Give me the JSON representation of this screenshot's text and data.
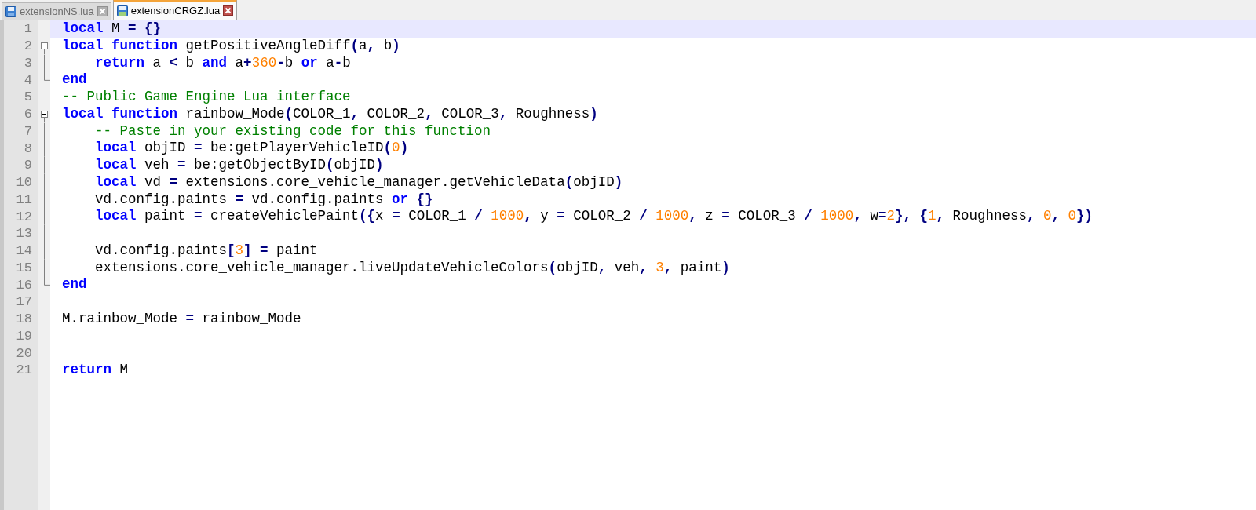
{
  "tabs": [
    {
      "label": "extensionNS.lua",
      "selected": false
    },
    {
      "label": "extensionCRGZ.lua",
      "selected": true
    }
  ],
  "editor": {
    "lines": [
      {
        "number": "1",
        "current": true,
        "kind": "plain",
        "tokens": [
          {
            "kind": "keyword",
            "text": "local"
          },
          {
            "kind": "text",
            "text": " M "
          },
          {
            "kind": "operator",
            "text": "= {}"
          }
        ]
      },
      {
        "number": "2",
        "current": false,
        "kind": "fold_start",
        "tokens": [
          {
            "kind": "keyword",
            "text": "local function"
          },
          {
            "kind": "text",
            "text": " getPositiveAngleDiff"
          },
          {
            "kind": "operator",
            "text": "("
          },
          {
            "kind": "text",
            "text": "a"
          },
          {
            "kind": "operator",
            "text": ","
          },
          {
            "kind": "text",
            "text": " b"
          },
          {
            "kind": "operator",
            "text": ")"
          }
        ]
      },
      {
        "number": "3",
        "current": false,
        "kind": "fold_body",
        "tokens": [
          {
            "kind": "keyword",
            "text": "    return"
          },
          {
            "kind": "text",
            "text": " a "
          },
          {
            "kind": "operator",
            "text": "<"
          },
          {
            "kind": "text",
            "text": " b "
          },
          {
            "kind": "keyword",
            "text": "and"
          },
          {
            "kind": "text",
            "text": " a"
          },
          {
            "kind": "operator",
            "text": "+"
          },
          {
            "kind": "number",
            "text": "360"
          },
          {
            "kind": "operator",
            "text": "-"
          },
          {
            "kind": "text",
            "text": "b "
          },
          {
            "kind": "keyword",
            "text": "or"
          },
          {
            "kind": "text",
            "text": " a"
          },
          {
            "kind": "operator",
            "text": "-"
          },
          {
            "kind": "text",
            "text": "b"
          }
        ]
      },
      {
        "number": "4",
        "current": false,
        "kind": "fold_end",
        "tokens": [
          {
            "kind": "keyword",
            "text": "end"
          }
        ]
      },
      {
        "number": "5",
        "current": false,
        "kind": "plain",
        "tokens": [
          {
            "kind": "comment",
            "text": "-- Public Game Engine Lua interface"
          }
        ]
      },
      {
        "number": "6",
        "current": false,
        "kind": "fold_start",
        "tokens": [
          {
            "kind": "keyword",
            "text": "local function"
          },
          {
            "kind": "text",
            "text": " rainbow_Mode"
          },
          {
            "kind": "operator",
            "text": "("
          },
          {
            "kind": "text",
            "text": "COLOR_1"
          },
          {
            "kind": "operator",
            "text": ","
          },
          {
            "kind": "text",
            "text": " COLOR_2"
          },
          {
            "kind": "operator",
            "text": ","
          },
          {
            "kind": "text",
            "text": " COLOR_3"
          },
          {
            "kind": "operator",
            "text": ","
          },
          {
            "kind": "text",
            "text": " Roughness"
          },
          {
            "kind": "operator",
            "text": ")"
          }
        ]
      },
      {
        "number": "7",
        "current": false,
        "kind": "fold_body",
        "tokens": [
          {
            "kind": "comment",
            "text": "    -- Paste in your existing code for this function"
          }
        ]
      },
      {
        "number": "8",
        "current": false,
        "kind": "fold_body",
        "tokens": [
          {
            "kind": "keyword",
            "text": "    local"
          },
          {
            "kind": "text",
            "text": " objID "
          },
          {
            "kind": "operator",
            "text": "="
          },
          {
            "kind": "text",
            "text": " be:getPlayerVehicleID"
          },
          {
            "kind": "operator",
            "text": "("
          },
          {
            "kind": "number",
            "text": "0"
          },
          {
            "kind": "operator",
            "text": ")"
          }
        ]
      },
      {
        "number": "9",
        "current": false,
        "kind": "fold_body",
        "tokens": [
          {
            "kind": "keyword",
            "text": "    local"
          },
          {
            "kind": "text",
            "text": " veh "
          },
          {
            "kind": "operator",
            "text": "="
          },
          {
            "kind": "text",
            "text": " be:getObjectByID"
          },
          {
            "kind": "operator",
            "text": "("
          },
          {
            "kind": "text",
            "text": "objID"
          },
          {
            "kind": "operator",
            "text": ")"
          }
        ]
      },
      {
        "number": "10",
        "current": false,
        "kind": "fold_body",
        "tokens": [
          {
            "kind": "keyword",
            "text": "    local"
          },
          {
            "kind": "text",
            "text": " vd "
          },
          {
            "kind": "operator",
            "text": "="
          },
          {
            "kind": "text",
            "text": " extensions.core_vehicle_manager.getVehicleData"
          },
          {
            "kind": "operator",
            "text": "("
          },
          {
            "kind": "text",
            "text": "objID"
          },
          {
            "kind": "operator",
            "text": ")"
          }
        ]
      },
      {
        "number": "11",
        "current": false,
        "kind": "fold_body",
        "tokens": [
          {
            "kind": "text",
            "text": "    vd.config.paints "
          },
          {
            "kind": "operator",
            "text": "="
          },
          {
            "kind": "text",
            "text": " vd.config.paints "
          },
          {
            "kind": "keyword",
            "text": "or"
          },
          {
            "kind": "operator",
            "text": " {}"
          }
        ]
      },
      {
        "number": "12",
        "current": false,
        "kind": "fold_body",
        "tokens": [
          {
            "kind": "keyword",
            "text": "    local"
          },
          {
            "kind": "text",
            "text": " paint "
          },
          {
            "kind": "operator",
            "text": "="
          },
          {
            "kind": "text",
            "text": " createVehiclePaint"
          },
          {
            "kind": "operator",
            "text": "({"
          },
          {
            "kind": "text",
            "text": "x "
          },
          {
            "kind": "operator",
            "text": "="
          },
          {
            "kind": "text",
            "text": " COLOR_1 "
          },
          {
            "kind": "operator",
            "text": "/ "
          },
          {
            "kind": "number",
            "text": "1000"
          },
          {
            "kind": "operator",
            "text": ","
          },
          {
            "kind": "text",
            "text": " y "
          },
          {
            "kind": "operator",
            "text": "="
          },
          {
            "kind": "text",
            "text": " COLOR_2 "
          },
          {
            "kind": "operator",
            "text": "/ "
          },
          {
            "kind": "number",
            "text": "1000"
          },
          {
            "kind": "operator",
            "text": ","
          },
          {
            "kind": "text",
            "text": " z "
          },
          {
            "kind": "operator",
            "text": "="
          },
          {
            "kind": "text",
            "text": " COLOR_3 "
          },
          {
            "kind": "operator",
            "text": "/ "
          },
          {
            "kind": "number",
            "text": "1000"
          },
          {
            "kind": "operator",
            "text": ","
          },
          {
            "kind": "text",
            "text": " w"
          },
          {
            "kind": "operator",
            "text": "="
          },
          {
            "kind": "number",
            "text": "2"
          },
          {
            "kind": "operator",
            "text": "}, {"
          },
          {
            "kind": "number",
            "text": "1"
          },
          {
            "kind": "operator",
            "text": ","
          },
          {
            "kind": "text",
            "text": " Roughness"
          },
          {
            "kind": "operator",
            "text": ", "
          },
          {
            "kind": "number",
            "text": "0"
          },
          {
            "kind": "operator",
            "text": ", "
          },
          {
            "kind": "number",
            "text": "0"
          },
          {
            "kind": "operator",
            "text": "})"
          }
        ]
      },
      {
        "number": "13",
        "current": false,
        "kind": "fold_body"
      },
      {
        "number": "14",
        "current": false,
        "kind": "fold_body",
        "tokens": [
          {
            "kind": "text",
            "text": "    vd.config.paints"
          },
          {
            "kind": "operator",
            "text": "["
          },
          {
            "kind": "number",
            "text": "3"
          },
          {
            "kind": "operator",
            "text": "] ="
          },
          {
            "kind": "text",
            "text": " paint"
          }
        ]
      },
      {
        "number": "15",
        "current": false,
        "kind": "fold_body",
        "tokens": [
          {
            "kind": "text",
            "text": "    extensions.core_vehicle_manager.liveUpdateVehicleColors"
          },
          {
            "kind": "operator",
            "text": "("
          },
          {
            "kind": "text",
            "text": "objID"
          },
          {
            "kind": "operator",
            "text": ","
          },
          {
            "kind": "text",
            "text": " veh"
          },
          {
            "kind": "operator",
            "text": ", "
          },
          {
            "kind": "number",
            "text": "3"
          },
          {
            "kind": "operator",
            "text": ","
          },
          {
            "kind": "text",
            "text": " paint"
          },
          {
            "kind": "operator",
            "text": ")"
          }
        ]
      },
      {
        "number": "16",
        "current": false,
        "kind": "fold_end",
        "tokens": [
          {
            "kind": "keyword",
            "text": "end"
          }
        ]
      },
      {
        "number": "17",
        "current": false,
        "kind": "plain"
      },
      {
        "number": "18",
        "current": false,
        "kind": "plain",
        "tokens": [
          {
            "kind": "text",
            "text": "M.rainbow_Mode "
          },
          {
            "kind": "operator",
            "text": "="
          },
          {
            "kind": "text",
            "text": " rainbow_Mode"
          }
        ]
      },
      {
        "number": "19",
        "current": false,
        "kind": "plain"
      },
      {
        "number": "20",
        "current": false,
        "kind": "plain"
      },
      {
        "number": "21",
        "current": false,
        "kind": "plain",
        "tokens": [
          {
            "kind": "keyword",
            "text": "return"
          },
          {
            "kind": "text",
            "text": " M"
          }
        ]
      }
    ]
  }
}
